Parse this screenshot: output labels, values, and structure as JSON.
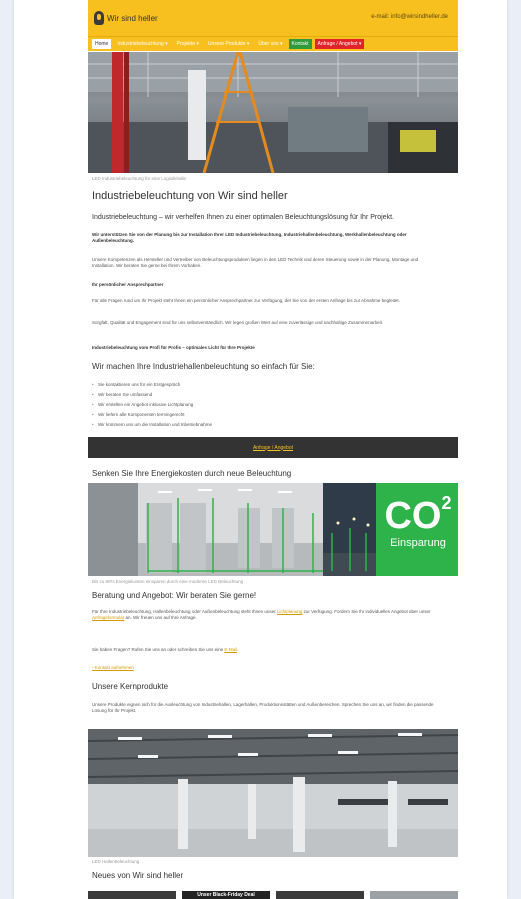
{
  "header": {
    "logo_text": "Wir sind heller",
    "contact": "e-mail: info@wirsindheller.de"
  },
  "nav": {
    "items": [
      {
        "label": "Home",
        "style": "home"
      },
      {
        "label": "Industriebeleuchtung ▾",
        "style": "plain"
      },
      {
        "label": "Projekte ▾",
        "style": "plain"
      },
      {
        "label": "Unsere Produkte ▾",
        "style": "plain"
      },
      {
        "label": "Über uns ▾",
        "style": "plain"
      },
      {
        "label": "Kontakt",
        "style": "green"
      },
      {
        "label": "Anfrage / Angebot ▾",
        "style": "red"
      }
    ]
  },
  "hero": {
    "caption": "LED Industriebeleuchtung für eine Logistikhalle"
  },
  "intro": {
    "title": "Industriebeleuchtung von Wir sind heller",
    "subtitle": "Industriebeleuchtung – wir verhelfen Ihnen zu einer optimalen Beleuchtungslösung für Ihr Projekt.",
    "p1": "Wir unterstützen Sie von der Planung bis zur Installation Ihrer LED Industriebeleuchtung, Industriehallenbeleuchtung, Werkhallenbeleuchtung oder Außenbeleuchtung.",
    "p2": "Unsere Kompetenzen als Hersteller und Vertreiber von Beleuchtungsprodukten liegen in den LED Technik und deren Steuerung sowie in der Planung, Montage und Installation. Wir beraten Sie gerne bei Ihrem Vorhaben.",
    "p3": "Ihr persönlicher Ansprechpartner",
    "p4": "Für alle Fragen rund um Ihr Projekt steht Ihnen ein persönlicher Ansprechpartner zur Verfügung, der Sie von der ersten Anfrage bis zur Abnahme begleitet.",
    "p5": "Sorgfalt, Qualität und Engagement sind für uns selbstverständlich. Wir legen großen Wert auf eine zuverlässige und nachhaltige Zusammenarbeit.",
    "p6": "Industriebeleuchtung vom Profi für Profis – optimales Licht für Ihre Projekte"
  },
  "process": {
    "title": "Wir machen Ihre Industriehallenbeleuchtung so einfach für Sie:",
    "items": [
      "Sie kontaktieren uns für ein Erstgespräch",
      "Wir beraten Sie umfassend",
      "Wir erstellen ein Angebot inklusive Lichtplanung",
      "Wir liefern alle Komponenten termingerecht",
      "Wir kümmern uns um die Installation und Inbetriebnahme"
    ],
    "cta_label": "Anfrage / Angebot"
  },
  "energy": {
    "title": "Senken Sie Ihre Energiekosten durch neue Beleuchtung",
    "co2": "CO",
    "co2_sub": "2",
    "saving": "Einsparung",
    "caption": "Bis zu 80% Energiekosten einsparen durch eine moderne LED Beleuchtung"
  },
  "consult": {
    "title": "Beratung und Angebot: Wir beraten Sie gerne!",
    "p1_a": "Für Ihre Industriebeleuchtung, Hallenbeleuchtung oder Außenbeleuchtung steht Ihnen unser ",
    "p1_link1": "Lichtplanung",
    "p1_b": " zur Verfügung. Fordern Sie Ihr individuelles Angebot über unser ",
    "p1_link2": "Anfrageformular",
    "p1_c": " an. Wir freuen uns auf Ihre Anfrage.",
    "p2_a": "Sie haben Fragen? Rufen Sie uns an oder schreiben Sie uns eine ",
    "p2_link": "E-Mail",
    "p2_b": ".",
    "link": "› Kontakt aufnehmen"
  },
  "products": {
    "title": "Unsere Kernprodukte",
    "p1": "Unsere Produkte eignen sich für die Ausleuchtung von Industriehallen, Lagerhallen, Produktionsstätten und Außenbereichen. Sprechen Sie uns an, wir finden die passende Lösung für Ihr Projekt.",
    "caption": "LED Hallenbeleuchtung"
  },
  "news": {
    "title": "Neues von Wir sind heller",
    "deal": "Unser Black-Friday Deal"
  }
}
